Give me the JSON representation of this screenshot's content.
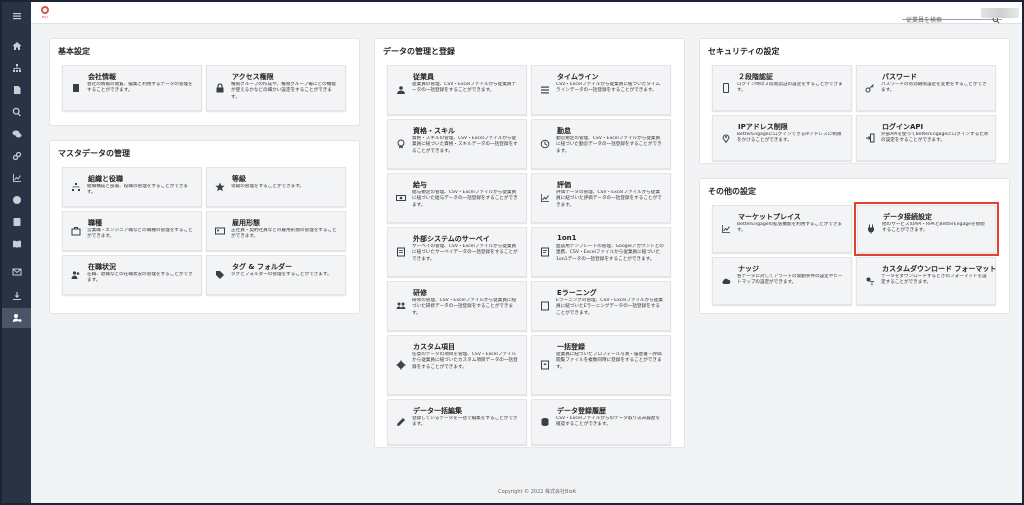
{
  "topbar": {
    "logo_text": "BizA",
    "search_placeholder": "従業員を検索"
  },
  "sidebar": {
    "items": [
      "menu",
      "home",
      "org",
      "document",
      "search",
      "chat",
      "link",
      "chart",
      "person-info",
      "contact",
      "book",
      "mail",
      "download",
      "user-settings"
    ]
  },
  "panels": {
    "basic": {
      "title": "基本設定",
      "cards": [
        {
          "title": "会社情報",
          "desc": "会社の情報の閲覧、編集と利用するデータの管理をすることができます。",
          "icon": "building-icon"
        },
        {
          "title": "アクセス権限",
          "desc": "権限グループの作成や、権限グループ毎にどの機能が使えるかなどの細かい設定をすることができます。",
          "icon": "lock-icon"
        }
      ]
    },
    "master": {
      "title": "マスタデータの管理",
      "cards": [
        {
          "title": "組織と役職",
          "desc": "組織構成と部署、役職の管理をすることができます。",
          "icon": "org-icon"
        },
        {
          "title": "等級",
          "desc": "等級の管理をすることができます。",
          "icon": "star-icon"
        },
        {
          "title": "職種",
          "desc": "営業職・エンジニア職などの職種の管理をすることができます。",
          "icon": "briefcase-icon"
        },
        {
          "title": "雇用形態",
          "desc": "正社員・契約社員などの雇用形態の管理をすることができます。",
          "icon": "id-card-icon"
        },
        {
          "title": "在職状況",
          "desc": "在職、退職などの在職状況の管理をすることができます。",
          "icon": "people-icon"
        },
        {
          "title": "タグ & フォルダー",
          "desc": "タグとフォルダーの管理をすることができます。",
          "icon": "tag-icon"
        }
      ]
    },
    "data": {
      "title": "データの管理と登録",
      "cards": [
        {
          "title": "従業員",
          "desc": "従業員の管理、CSV・Excelファイルから従業員データの一括登録をすることができます。",
          "icon": "employees-icon"
        },
        {
          "title": "タイムライン",
          "desc": "CSV・Excelファイルから従業員に紐づいたタイムラインデータの一括登録をすることができます。",
          "icon": "timeline-icon"
        },
        {
          "title": "資格・スキル",
          "desc": "資格・スキルの管理、CSV・Excelファイルから従業員に紐づいた資格・スキルデータの一括登録をすることができます。",
          "icon": "certificate-icon"
        },
        {
          "title": "勤怠",
          "desc": "勤怠規定の管理、CSV・Excelファイルから従業員に紐づいた勤怠データの一括登録をすることができます。",
          "icon": "clock-icon"
        },
        {
          "title": "給与",
          "desc": "給与規定の管理、CSV・Excelファイルから従業員に紐づいた給与データの一括登録をすることができます。",
          "icon": "money-icon"
        },
        {
          "title": "評価",
          "desc": "評価データの管理、CSV・Excelファイルから従業員に紐づいた評価データの一括登録をすることができます。",
          "icon": "evaluation-icon"
        },
        {
          "title": "外部システムのサーベイ",
          "desc": "サーベイの管理、CSV・Excelファイルから従業員に紐づいたサーベイデータの一括登録をすることができます。",
          "icon": "survey-icon"
        },
        {
          "title": "1on1",
          "desc": "面談用テンプレートの管理、Googleアカウントとの連携、CSV・Excelファイルから従業員に紐づいた1on1データの一括登録をすることができます。",
          "icon": "meeting-icon"
        },
        {
          "title": "研修",
          "desc": "研修の管理、CSV・Excelファイルから従業員に紐づいた研修データの一括登録をすることができます。",
          "icon": "training-icon"
        },
        {
          "title": "Eラーニング",
          "desc": "Eラーニングの管理、CSV・Excelファイルから従業員に紐づいたEラーニングデータの一括登録をすることができます。",
          "icon": "elearning-icon"
        },
        {
          "title": "カスタム項目",
          "desc": "任意のデータの項目を管理、CSV・Excelファイルから従業員に紐づいたカスタム項目データの一括登録をすることができます。",
          "icon": "gear-icon"
        },
        {
          "title": "一括登録",
          "desc": "従業員に紐づいたプロフィール写真・履歴書・評価閲覧ファイルを複数同時に登録をすることができます。",
          "icon": "upload-icon"
        },
        {
          "title": "データ一括編集",
          "desc": "登録しているデータを一括で編集をすることができます。",
          "icon": "edit-icon"
        },
        {
          "title": "データ登録履歴",
          "desc": "CSV・Excelファイルからのデータ取り込み履歴を確認することができます。",
          "icon": "history-icon"
        }
      ]
    },
    "security": {
      "title": "セキュリティの設定",
      "cards": [
        {
          "title": "２段階認証",
          "desc": "ログイン時の２段階認証の設定をすることができます。",
          "icon": "phone-icon"
        },
        {
          "title": "パスワード",
          "desc": "パスワードの有効期限設定を変更をすることができます。",
          "icon": "key-icon"
        },
        {
          "title": "IPアドレス制限",
          "desc": "BetterEngageにログインできるIPアドレスに制限をかけることができます。",
          "icon": "location-icon"
        },
        {
          "title": "ログインAPI",
          "desc": "外部APIを使ってBetterEngageにログインするための設定をすることができます。",
          "icon": "login-icon"
        }
      ]
    },
    "other": {
      "title": "その他の設定",
      "cards": [
        {
          "title": "マーケットプレイス",
          "desc": "BetterEngageの拡張機能を利用することができます。",
          "icon": "chart-icon"
        },
        {
          "title": "データ接続設定",
          "desc": "他のサービスのAPI・RPAとBetterEngageを接続することができます。",
          "icon": "plug-icon"
        },
        {
          "title": "ナッジ",
          "desc": "各データに対してアラートの発動条件の設定やヒートマップの設定ができます。",
          "icon": "cloud-icon"
        },
        {
          "title": "カスタムダウンロード フォーマット",
          "desc": "データをダウンロードするときのフォーマットを設定することができます。",
          "icon": "download-format-icon"
        }
      ]
    }
  },
  "footer": {
    "copyright": "Copyright © 2022 株式会社BizA"
  },
  "colors": {
    "highlight": "#e2412f",
    "sidebar": "#2a3345"
  }
}
